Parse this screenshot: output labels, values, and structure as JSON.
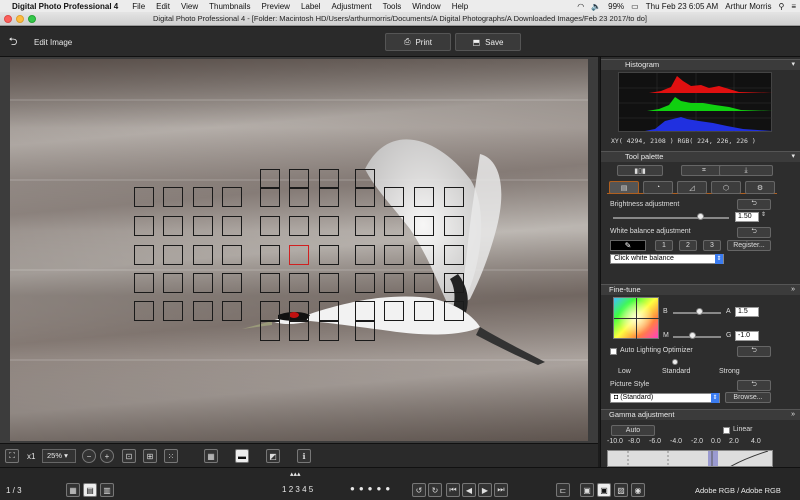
{
  "menubar": {
    "app_name": "Digital Photo Professional 4",
    "menus": [
      "File",
      "Edit",
      "View",
      "Thumbnails",
      "Preview",
      "Label",
      "Adjustment",
      "Tools",
      "Window",
      "Help"
    ],
    "battery": "99%",
    "clock": "Thu Feb 23  6:05 AM",
    "user": "Arthur Morris"
  },
  "window": {
    "title": "Digital Photo Professional 4 - [Folder: Macintosh HD/Users/arthurmorris/Documents/A Digital Photographs/A Downloaded Images/Feb 23 2017/to do]"
  },
  "toolbar": {
    "mode_label": "Edit Image",
    "print_label": "Print",
    "save_label": "Save"
  },
  "bottom_toolbar": {
    "zoom_x1": "x1",
    "zoom_value": "25%"
  },
  "status": {
    "page_counter": "1 / 3",
    "ratings": [
      "1",
      "2",
      "3",
      "4",
      "5"
    ],
    "color_space": "Adobe RGB / Adobe RGB"
  },
  "histogram": {
    "title": "Histogram",
    "readout": "XY(  4294,  2108 ) RGB( 224, 226, 226 )",
    "colors": {
      "red": "#e01010",
      "green": "#10d010",
      "blue": "#2030e0"
    }
  },
  "tool_palette": {
    "title": "Tool palette",
    "brightness": {
      "label": "Brightness adjustment",
      "value": "1.50",
      "level": 0.75
    },
    "white_balance": {
      "label": "White balance adjustment",
      "presets": [
        "1",
        "2",
        "3"
      ],
      "register_label": "Register...",
      "mode": "Click white balance"
    }
  },
  "fine_tune": {
    "title": "Fine-tune",
    "b_label": "B",
    "a_label": "A",
    "a_value": "1.5",
    "m_label": "M",
    "g_label": "G",
    "g_value": "-1.0",
    "auto_lighting_label": "Auto Lighting Optimizer",
    "levels": [
      "Low",
      "Standard",
      "Strong"
    ],
    "picture_style_label": "Picture Style",
    "picture_style_value": "(Standard)",
    "browse_label": "Browse..."
  },
  "gamma": {
    "title": "Gamma adjustment",
    "auto_label": "Auto",
    "linear_label": "Linear",
    "ticks": [
      "-10.0",
      "-8.0",
      "-6.0",
      "-4.0",
      "-2.0",
      "0.0",
      "2.0",
      "4.0"
    ]
  },
  "accent": "#3b7cf0"
}
